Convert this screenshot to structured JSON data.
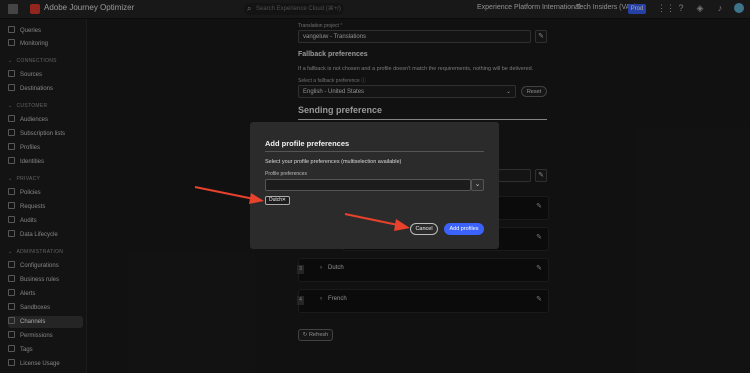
{
  "topbar": {
    "app_name": "Adobe Journey Optimizer",
    "search_placeholder": "Search Experience Cloud (⌘+/)",
    "org": "Experience Platform International",
    "sandbox": "Tech Insiders (VA7)",
    "env_badge": "Prod"
  },
  "sidebar": {
    "items_top": [
      "Queries",
      "Monitoring"
    ],
    "sections": [
      {
        "title": "CONNECTIONS",
        "items": [
          "Sources",
          "Destinations"
        ]
      },
      {
        "title": "CUSTOMER",
        "items": [
          "Audiences",
          "Subscription lists",
          "Profiles",
          "Identities"
        ]
      },
      {
        "title": "PRIVACY",
        "items": [
          "Policies",
          "Requests",
          "Audits",
          "Data Lifecycle"
        ]
      },
      {
        "title": "ADMINISTRATION",
        "items": [
          "Configurations",
          "Business rules",
          "Alerts",
          "Sandboxes",
          "Channels",
          "Permissions",
          "Tags",
          "License Usage"
        ]
      }
    ],
    "active": "Channels"
  },
  "main": {
    "translation_project_label": "Translation project",
    "translation_project_required": "*",
    "translation_project_value": "vangeluw - Translations",
    "fallback_heading": "Fallback preferences",
    "fallback_desc": "If a fallback is not chosen and a profile doesn't match the requirements, nothing will be delivered.",
    "select_fallback_label": "Select a fallback preference",
    "fallback_value": "English - United States",
    "reset_label": "Reset",
    "sending_heading": "Sending preference",
    "rows": [
      {
        "num": "3",
        "name": "Dutch"
      },
      {
        "num": "4",
        "name": "French"
      }
    ],
    "refresh_label": "Refresh"
  },
  "modal": {
    "title": "Add profile preferences",
    "subtitle": "Select your profile preferences (multiselection available)",
    "field_label": "Profile preferences",
    "selected_tag": "Dutch",
    "cancel_label": "Cancel",
    "add_label": "Add profiles"
  },
  "colors": {
    "accent": "#3b63fb",
    "annotation_arrow": "#e8412c"
  }
}
